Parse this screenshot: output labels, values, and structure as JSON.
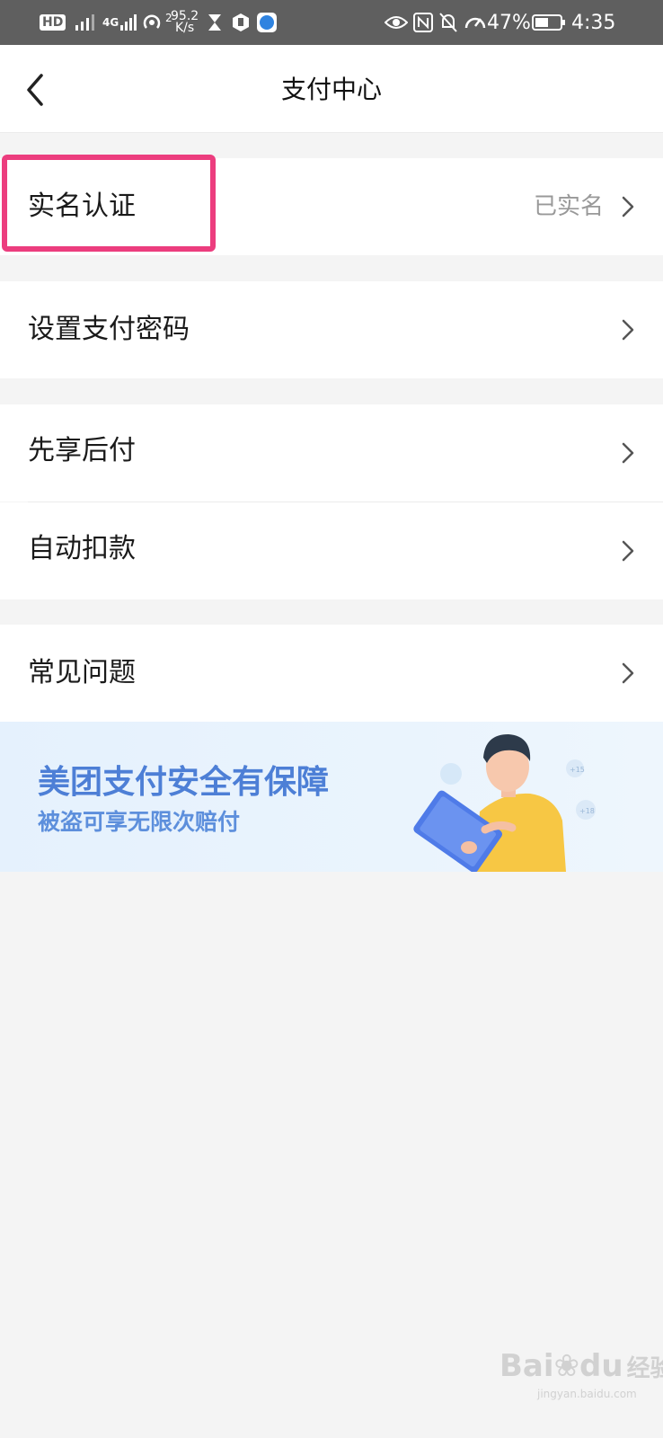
{
  "status_bar": {
    "network_hd": "HD",
    "network_4g": "4G",
    "speed_value": "95.2",
    "speed_unit": "K/s",
    "hotspot_count": "2",
    "battery_percent": "47%",
    "time": "4:35"
  },
  "header": {
    "title": "支付中心"
  },
  "menu": {
    "real_name": {
      "label": "实名认证",
      "value": "已实名"
    },
    "set_password": {
      "label": "设置支付密码"
    },
    "pay_later": {
      "label": "先享后付"
    },
    "auto_debit": {
      "label": "自动扣款"
    },
    "faq": {
      "label": "常见问题"
    }
  },
  "banner": {
    "title": "美团支付安全有保障",
    "subtitle": "被盗可享无限次赔付",
    "bubble_1": "+15",
    "bubble_2": "+18"
  },
  "watermark": {
    "brand": "Bai",
    "brand_suffix": "du",
    "product": "经验",
    "url": "jingyan.baidu.com"
  },
  "colors": {
    "highlight_border": "#ec3d7e",
    "banner_text": "#4d7fd6",
    "status_bar_bg": "#5f5f5f"
  }
}
